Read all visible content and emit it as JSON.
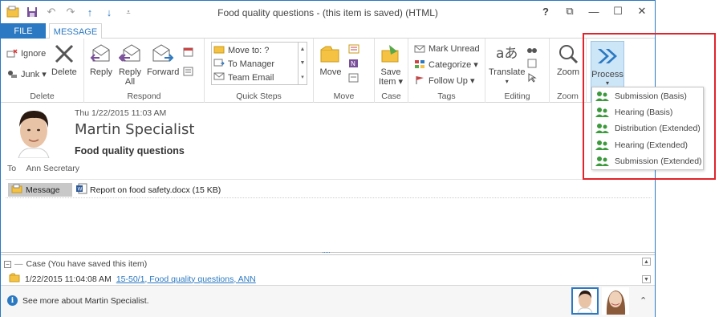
{
  "window": {
    "title": "Food quality questions - (this item is saved) (HTML)",
    "controls": [
      "?",
      "⧉",
      "—",
      "☐",
      "✕"
    ]
  },
  "qat": [
    "save-icon",
    "undo-icon",
    "redo-icon",
    "up-icon",
    "down-icon"
  ],
  "tabs": {
    "file": "FILE",
    "message": "MESSAGE"
  },
  "ribbon": {
    "delete": {
      "ignore": "Ignore",
      "junk": "Junk ▾",
      "delete": "Delete",
      "label": "Delete"
    },
    "respond": {
      "reply": "Reply",
      "reply_all_1": "Reply",
      "reply_all_2": "All",
      "forward": "Forward",
      "label": "Respond"
    },
    "quick_steps": {
      "items": [
        "Move to: ?",
        "To Manager",
        "Team Email"
      ],
      "label": "Quick Steps"
    },
    "move": {
      "move": "Move",
      "label": "Move"
    },
    "case": {
      "save_item_1": "Save",
      "save_item_2": "Item ▾",
      "label": "Case"
    },
    "tags": {
      "mark_unread": "Mark Unread",
      "categorize": "Categorize ▾",
      "follow_up": "Follow Up ▾",
      "label": "Tags"
    },
    "editing": {
      "translate": "Translate",
      "label": "Editing"
    },
    "zoom": {
      "zoom": "Zoom",
      "label": "Zoom"
    },
    "process": {
      "label": "Process",
      "arrow": "▾"
    }
  },
  "process_menu": {
    "items": [
      "Submission (Basis)",
      "Hearing (Basis)",
      "Distribution (Extended)",
      "Hearing (Extended)",
      "Submission (Extended)"
    ]
  },
  "message": {
    "date": "Thu 1/22/2015 11:03 AM",
    "sender": "Martin Specialist",
    "subject": "Food quality questions",
    "to_label": "To",
    "to_value": "Ann Secretary",
    "attachments": {
      "message": "Message",
      "document": "Report on food safety.docx (15 KB)"
    }
  },
  "case_pane": {
    "header": "Case (You have saved this item)",
    "row_time": "1/22/2015 11:04:08 AM",
    "row_link": "15-50/1, Food quality questions, ANN"
  },
  "people_bar": {
    "see_more": "See more about Martin Specialist."
  },
  "colors": {
    "accent": "#2b79c2",
    "highlight": "#e0242b",
    "process_bg": "#cde6f7",
    "icon_green": "#3c9a3c"
  }
}
